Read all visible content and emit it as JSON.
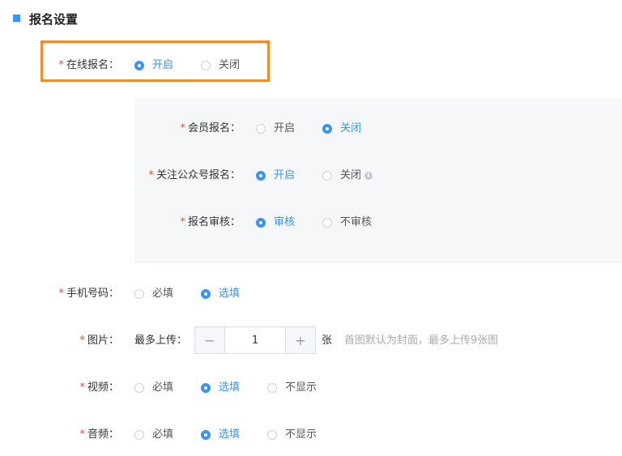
{
  "section": {
    "title": "报名设置"
  },
  "required_mark": "*",
  "online_signup": {
    "label": "在线报名：",
    "options": [
      "开启",
      "关闭"
    ],
    "selected": 0
  },
  "member_signup": {
    "label": "会员报名：",
    "options": [
      "开启",
      "关闭"
    ],
    "selected": 1
  },
  "follow_official": {
    "label": "关注公众号报名：",
    "options": [
      "开启",
      "关闭"
    ],
    "selected": 0
  },
  "review": {
    "label": "报名审核：",
    "options": [
      "审核",
      "不审核"
    ],
    "selected": 0
  },
  "phone": {
    "label": "手机号码：",
    "options": [
      "必填",
      "选填"
    ],
    "selected": 1
  },
  "image": {
    "label": "图片：",
    "max_upload_label": "最多上传：",
    "stepper": {
      "minus": "−",
      "value": "1",
      "plus": "+"
    },
    "unit": "张",
    "hint": "首图默认为封面，最多上传9张图"
  },
  "video": {
    "label": "视频：",
    "options": [
      "必填",
      "选填",
      "不显示"
    ],
    "selected": 1
  },
  "audio": {
    "label": "音频：",
    "options": [
      "必填",
      "选填",
      "不显示"
    ],
    "selected": 1
  },
  "info_icon_glyph": "i",
  "colors": {
    "accent": "#3b93f5",
    "required": "#f0492b",
    "highlight": "#f68a2a",
    "panel": "#f6f7f9"
  }
}
